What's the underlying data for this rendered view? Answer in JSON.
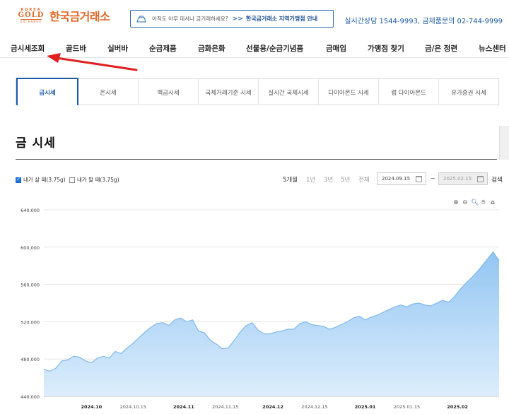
{
  "header": {
    "logo_small_top": "KOREA",
    "logo_mark": "GOLD",
    "logo_small_bottom": "EXCHANGE",
    "logo_text": "한국금거래소",
    "promo_question": "아직도 아무 데서나 금거래하세요?",
    "promo_arrow": ">>",
    "promo_link": "한국금거래소 지역가맹점 안내",
    "contact": "실시간상담 1544-9993, 금제품문의 02-744-9999"
  },
  "nav": {
    "items": [
      "금시세조회",
      "골드바",
      "실버바",
      "순금제품",
      "금화은화",
      "선물용/순금기념품",
      "금매입",
      "가맹점 찾기",
      "금/은 정련",
      "뉴스센터"
    ]
  },
  "tabs": {
    "items": [
      "금시세",
      "은시세",
      "백금시세",
      "국제거래기준 시세",
      "실시간 국제시세",
      "다이아몬드 시세",
      "랩 다이아몬드",
      "유가증권 시세"
    ],
    "active_index": 0
  },
  "section_title": "금 시세",
  "controls": {
    "buy_label": "내가 살 때(3.75g)",
    "buy_checked": true,
    "sell_label": "내가 팔 때(3.75g)",
    "sell_checked": false,
    "periods": [
      "5개월",
      "1년",
      "3년",
      "5년",
      "전체"
    ],
    "active_period": "5개월",
    "date_from": "2024.09.15",
    "date_separator": "~",
    "date_to": "2025.02.15",
    "search_label": "검색"
  },
  "chart_tools": [
    "zoom-in-icon",
    "zoom-out-icon",
    "magnifier-icon",
    "pan-hand-icon",
    "home-icon"
  ],
  "chart_data": {
    "type": "area",
    "title": "",
    "xlabel": "",
    "ylabel": "",
    "ylim": [
      440000,
      640000
    ],
    "y_ticks": [
      "440,000",
      "480,000",
      "520,000",
      "560,000",
      "600,000",
      "640,000"
    ],
    "x_ticks": [
      {
        "label": "2024.10",
        "date": "2024-10-01",
        "bold": true
      },
      {
        "label": "2024.10.15",
        "date": "2024-10-15",
        "bold": false
      },
      {
        "label": "2024.11",
        "date": "2024-11-01",
        "bold": true
      },
      {
        "label": "2024.11.15",
        "date": "2024-11-15",
        "bold": false
      },
      {
        "label": "2024.12",
        "date": "2024-12-01",
        "bold": true
      },
      {
        "label": "2024.12.15",
        "date": "2024-12-15",
        "bold": false
      },
      {
        "label": "2025.01",
        "date": "2025-01-01",
        "bold": true
      },
      {
        "label": "2025.01.15",
        "date": "2025-01-15",
        "bold": false
      },
      {
        "label": "2025.02",
        "date": "2025-02-01",
        "bold": true
      }
    ],
    "x_range": [
      "2024-09-15",
      "2025-02-15"
    ],
    "grid": true,
    "color": "#7fb8ee",
    "series": [
      {
        "name": "",
        "points": [
          [
            "2024-09-15",
            469000
          ],
          [
            "2024-09-17",
            467000
          ],
          [
            "2024-09-19",
            470000
          ],
          [
            "2024-09-21",
            478000
          ],
          [
            "2024-09-23",
            479000
          ],
          [
            "2024-09-25",
            483000
          ],
          [
            "2024-09-27",
            482000
          ],
          [
            "2024-09-29",
            478000
          ],
          [
            "2024-10-01",
            476000
          ],
          [
            "2024-10-03",
            481000
          ],
          [
            "2024-10-05",
            483000
          ],
          [
            "2024-10-07",
            481000
          ],
          [
            "2024-10-09",
            488000
          ],
          [
            "2024-10-11",
            486000
          ],
          [
            "2024-10-13",
            492000
          ],
          [
            "2024-10-15",
            497000
          ],
          [
            "2024-10-17",
            503000
          ],
          [
            "2024-10-19",
            509000
          ],
          [
            "2024-10-21",
            514000
          ],
          [
            "2024-10-23",
            518000
          ],
          [
            "2024-10-25",
            519000
          ],
          [
            "2024-10-27",
            516000
          ],
          [
            "2024-10-29",
            522000
          ],
          [
            "2024-10-31",
            524000
          ],
          [
            "2024-11-02",
            520000
          ],
          [
            "2024-11-04",
            522000
          ],
          [
            "2024-11-06",
            510000
          ],
          [
            "2024-11-08",
            508000
          ],
          [
            "2024-11-10",
            500000
          ],
          [
            "2024-11-12",
            496000
          ],
          [
            "2024-11-14",
            491000
          ],
          [
            "2024-11-16",
            492000
          ],
          [
            "2024-11-18",
            500000
          ],
          [
            "2024-11-20",
            509000
          ],
          [
            "2024-11-22",
            516000
          ],
          [
            "2024-11-24",
            519000
          ],
          [
            "2024-11-26",
            511000
          ],
          [
            "2024-11-28",
            507000
          ],
          [
            "2024-11-30",
            507000
          ],
          [
            "2024-12-02",
            509000
          ],
          [
            "2024-12-04",
            510000
          ],
          [
            "2024-12-06",
            512000
          ],
          [
            "2024-12-08",
            512000
          ],
          [
            "2024-12-10",
            518000
          ],
          [
            "2024-12-12",
            520000
          ],
          [
            "2024-12-14",
            517000
          ],
          [
            "2024-12-16",
            516000
          ],
          [
            "2024-12-18",
            515000
          ],
          [
            "2024-12-20",
            512000
          ],
          [
            "2024-12-22",
            514000
          ],
          [
            "2024-12-24",
            517000
          ],
          [
            "2024-12-26",
            520000
          ],
          [
            "2024-12-28",
            524000
          ],
          [
            "2024-12-30",
            526000
          ],
          [
            "2025-01-01",
            522000
          ],
          [
            "2025-01-03",
            525000
          ],
          [
            "2025-01-05",
            527000
          ],
          [
            "2025-01-07",
            530000
          ],
          [
            "2025-01-09",
            533000
          ],
          [
            "2025-01-11",
            536000
          ],
          [
            "2025-01-13",
            538000
          ],
          [
            "2025-01-15",
            536000
          ],
          [
            "2025-01-17",
            539000
          ],
          [
            "2025-01-19",
            540000
          ],
          [
            "2025-01-21",
            538000
          ],
          [
            "2025-01-23",
            537000
          ],
          [
            "2025-01-25",
            540000
          ],
          [
            "2025-01-27",
            543000
          ],
          [
            "2025-01-29",
            541000
          ],
          [
            "2025-01-31",
            547000
          ],
          [
            "2025-02-02",
            555000
          ],
          [
            "2025-02-04",
            562000
          ],
          [
            "2025-02-06",
            568000
          ],
          [
            "2025-02-08",
            575000
          ],
          [
            "2025-02-10",
            583000
          ],
          [
            "2025-02-12",
            591000
          ],
          [
            "2025-02-13",
            595000
          ],
          [
            "2025-02-14",
            590000
          ],
          [
            "2025-02-15",
            586000
          ]
        ]
      }
    ]
  }
}
